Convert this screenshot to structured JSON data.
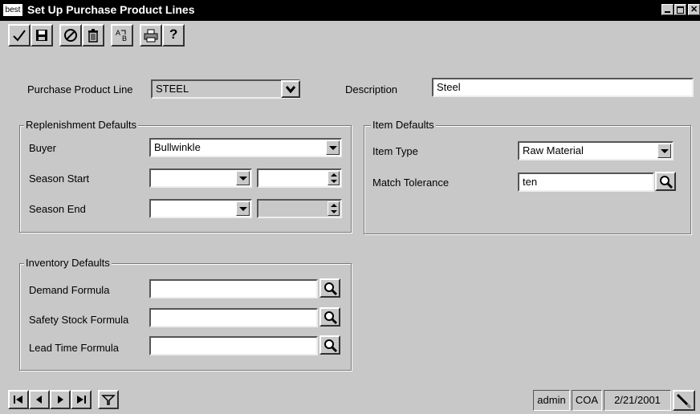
{
  "window": {
    "app_icon_text": "best",
    "title": "Set Up Purchase Product Lines",
    "controls": [
      "minimize",
      "maximize",
      "close"
    ]
  },
  "toolbar": {
    "buttons": [
      {
        "icon": "checkmark-icon",
        "label": "Accept"
      },
      {
        "icon": "save-icon",
        "label": "Save"
      },
      {
        "icon": "cancel-icon",
        "label": "Cancel"
      },
      {
        "icon": "delete-icon",
        "label": "Delete"
      },
      {
        "icon": "spell-icon",
        "label": "Spelling"
      },
      {
        "icon": "print-icon",
        "label": "Print"
      },
      {
        "icon": "help-icon",
        "label": "?"
      }
    ]
  },
  "header": {
    "product_line_label": "Purchase Product Line",
    "product_line_value": "STEEL",
    "description_label": "Description",
    "description_value": "Steel"
  },
  "replenishment": {
    "legend": "Replenishment Defaults",
    "buyer_label": "Buyer",
    "buyer_value": "Bullwinkle",
    "season_start_label": "Season Start",
    "season_start_value": "",
    "season_start_day": "",
    "season_end_label": "Season End",
    "season_end_value": "",
    "season_end_day": ""
  },
  "item_defaults": {
    "legend": "Item Defaults",
    "item_type_label": "Item Type",
    "item_type_value": "Raw Material",
    "match_tolerance_label": "Match Tolerance",
    "match_tolerance_value": "ten"
  },
  "inventory": {
    "legend": "Inventory Defaults",
    "demand_label": "Demand Formula",
    "demand_value": "",
    "safety_label": "Safety Stock Formula",
    "safety_value": "",
    "lead_label": "Lead Time Formula",
    "lead_value": ""
  },
  "navigation": {
    "buttons": [
      "first-record",
      "previous-record",
      "next-record",
      "last-record",
      "filter"
    ]
  },
  "statusbar": {
    "user": "admin",
    "company": "COA",
    "date": "2/21/2001"
  }
}
